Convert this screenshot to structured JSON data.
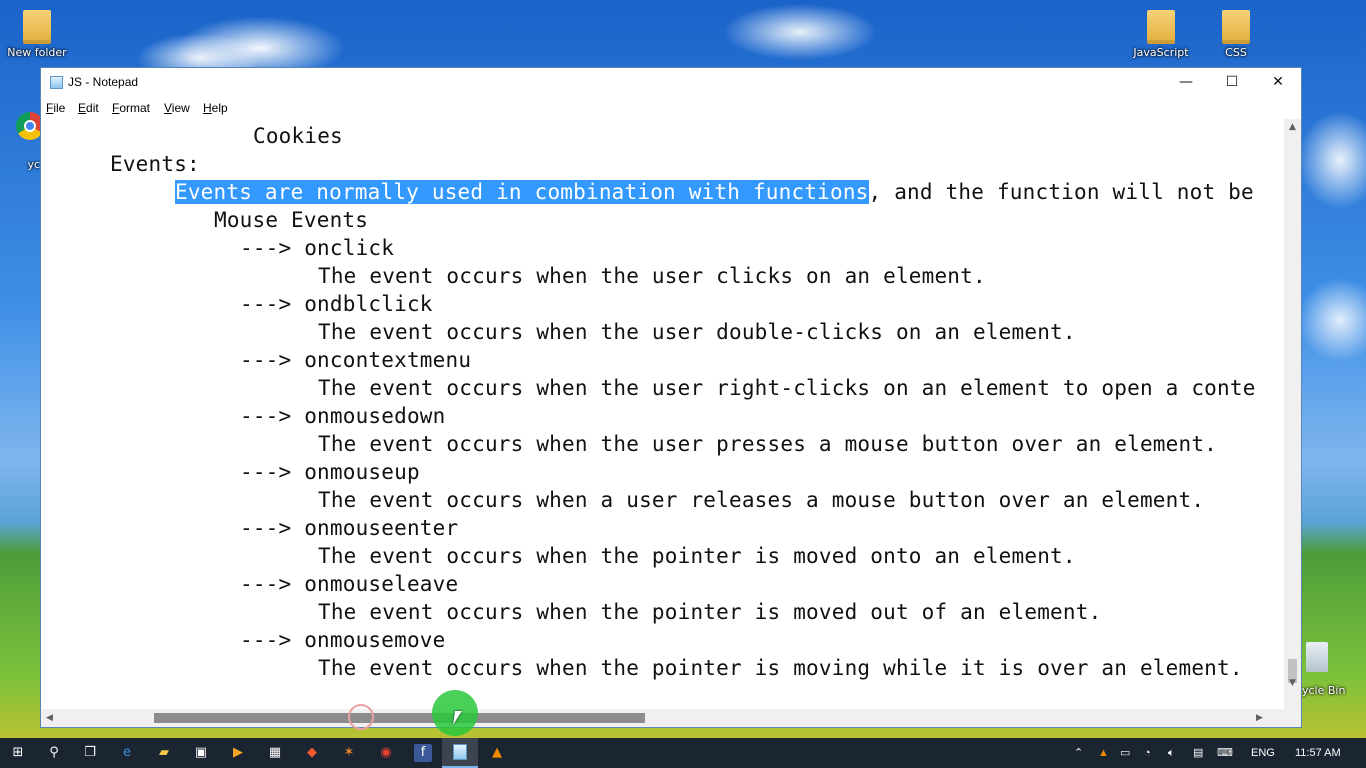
{
  "desktop": {
    "icons": [
      {
        "label": "New folder",
        "icon": "folder-icon"
      },
      {
        "label": "JavaScript",
        "icon": "folder-icon"
      },
      {
        "label": "CSS",
        "icon": "folder-icon"
      },
      {
        "label": "yc",
        "icon": "chrome-icon"
      },
      {
        "label": "ycle Bin",
        "icon": "recycle-bin-icon"
      }
    ]
  },
  "window": {
    "title": "JS - Notepad",
    "minimize_glyph": "—",
    "maximize_glyph": "☐",
    "close_glyph": "✕"
  },
  "menu": [
    "File",
    "Edit",
    "Format",
    "View",
    "Help"
  ],
  "editor": {
    "lines": [
      {
        "indent": 16,
        "text": "Cookies"
      },
      {
        "indent": 5,
        "text": "Events:"
      },
      {
        "indent": 10,
        "selected": "Events are normally used in combination with functions",
        "text": ", and the function will not be"
      },
      {
        "indent": 13,
        "text": "Mouse Events"
      },
      {
        "indent": 15,
        "text": "---> onclick"
      },
      {
        "indent": 21,
        "text": "The event occurs when the user clicks on an element."
      },
      {
        "indent": 15,
        "text": "---> ondblclick"
      },
      {
        "indent": 21,
        "text": "The event occurs when the user double-clicks on an element."
      },
      {
        "indent": 15,
        "text": "---> oncontextmenu"
      },
      {
        "indent": 21,
        "text": "The event occurs when the user right-clicks on an element to open a conte"
      },
      {
        "indent": 15,
        "text": "---> onmousedown"
      },
      {
        "indent": 21,
        "text": "The event occurs when the user presses a mouse button over an element."
      },
      {
        "indent": 15,
        "text": "---> onmouseup"
      },
      {
        "indent": 21,
        "text": "The event occurs when a user releases a mouse button over an element."
      },
      {
        "indent": 15,
        "text": "---> onmouseenter"
      },
      {
        "indent": 21,
        "text": "The event occurs when the pointer is moved onto an element."
      },
      {
        "indent": 15,
        "text": "---> onmouseleave"
      },
      {
        "indent": 21,
        "text": "The event occurs when the pointer is moved out of an element."
      },
      {
        "indent": 15,
        "text": "---> onmousemove"
      },
      {
        "indent": 21,
        "text": "The event occurs when the pointer is moving while it is over an element."
      }
    ],
    "selection_color": "#3399ff"
  },
  "taskbar": {
    "apps": [
      "windows-start-icon",
      "search-icon",
      "task-view-icon",
      "edge-icon",
      "file-explorer-icon",
      "store-icon",
      "media-player-icon",
      "calculator-icon",
      "brave-icon",
      "app-icon",
      "chrome-icon",
      "facebook-icon",
      "notepad-icon",
      "vlc-icon"
    ],
    "language": "ENG",
    "time": "11:57 AM"
  }
}
